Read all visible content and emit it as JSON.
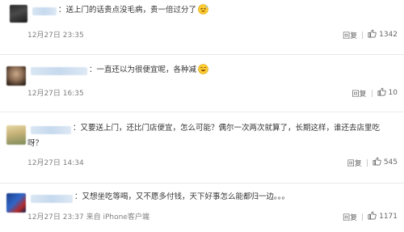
{
  "comments": [
    {
      "body": "：送上门的话贵点没毛病，贵一倍过分了",
      "emoji": "grinning-sweat",
      "date": "12月27日 23:35",
      "source": "",
      "reply_label": "回复",
      "likes": "1342"
    },
    {
      "body": "：一直还以为很便宜呢，各种减",
      "emoji": "laughing-tears",
      "date": "12月27日 16:35",
      "source": "",
      "reply_label": "回复",
      "likes": "10"
    },
    {
      "body_line1": "：又要送上门，还比门店便宜，怎么可能？偶尔一次两次就算了，长期这样，谁还去店里吃",
      "body_line2": "呀？",
      "date": "12月27日 14:34",
      "source": "",
      "reply_label": "回复",
      "likes": "545"
    },
    {
      "body": "：又想坐吃等喝，又不愿多付钱，天下好事怎么能都归一边。。。",
      "date": "12月27日 23:37",
      "source": "来自 iPhone客户端",
      "reply_label": "回复",
      "likes": "1171"
    }
  ],
  "colors": {
    "text": "#333333",
    "meta": "#808080",
    "divider": "#e9e9e9",
    "emoji_face": "#ffcc33"
  }
}
